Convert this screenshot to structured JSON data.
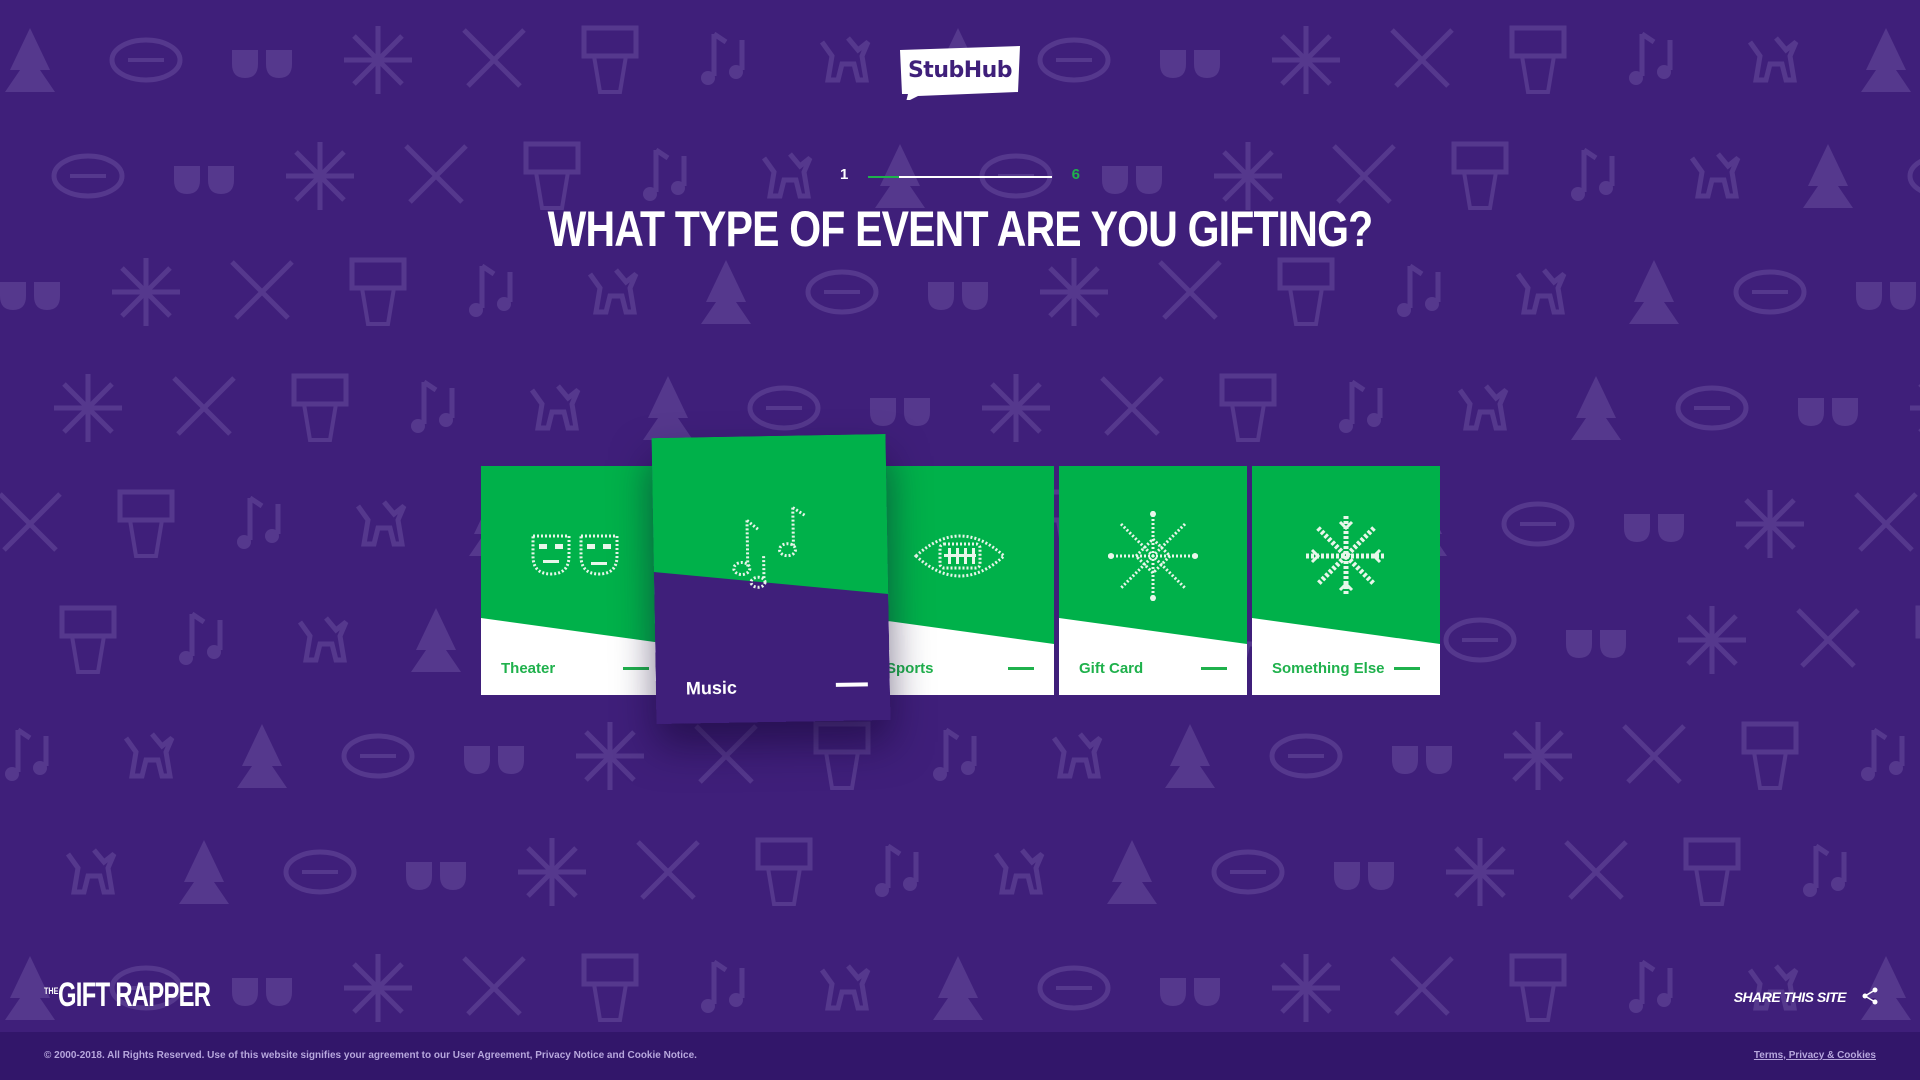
{
  "header": {
    "logo_text": "StubHub",
    "logo_icon": "stubhub-logo"
  },
  "progress": {
    "current": "1",
    "total": "6",
    "fraction_complete": 0.167
  },
  "question": {
    "title": "WHAT TYPE OF EVENT ARE YOU GIFTING?"
  },
  "cards": [
    {
      "label": "Theater",
      "icon": "theater-masks-icon"
    },
    {
      "label": "Music",
      "icon": "music-notes-icon",
      "selected": true
    },
    {
      "label": "Sports",
      "icon": "football-icon"
    },
    {
      "label": "Gift Card",
      "icon": "snowflake-icon"
    },
    {
      "label": "Something Else",
      "icon": "snowflake-icon"
    }
  ],
  "brand": {
    "prefix": "THE",
    "name": "GIFT RAPPER"
  },
  "share": {
    "label": "SHARE THIS SITE",
    "icon": "share-icon"
  },
  "footer": {
    "legal": "© 2000-2018. All Rights Reserved. Use of this website signifies your agreement to our User Agreement, Privacy Notice and Cookie Notice.",
    "terms_link": "Terms, Privacy & Cookies"
  },
  "colors": {
    "background": "#3f1f7a",
    "accent_green": "#1fb14c",
    "footer": "#32166a",
    "white": "#ffffff"
  }
}
